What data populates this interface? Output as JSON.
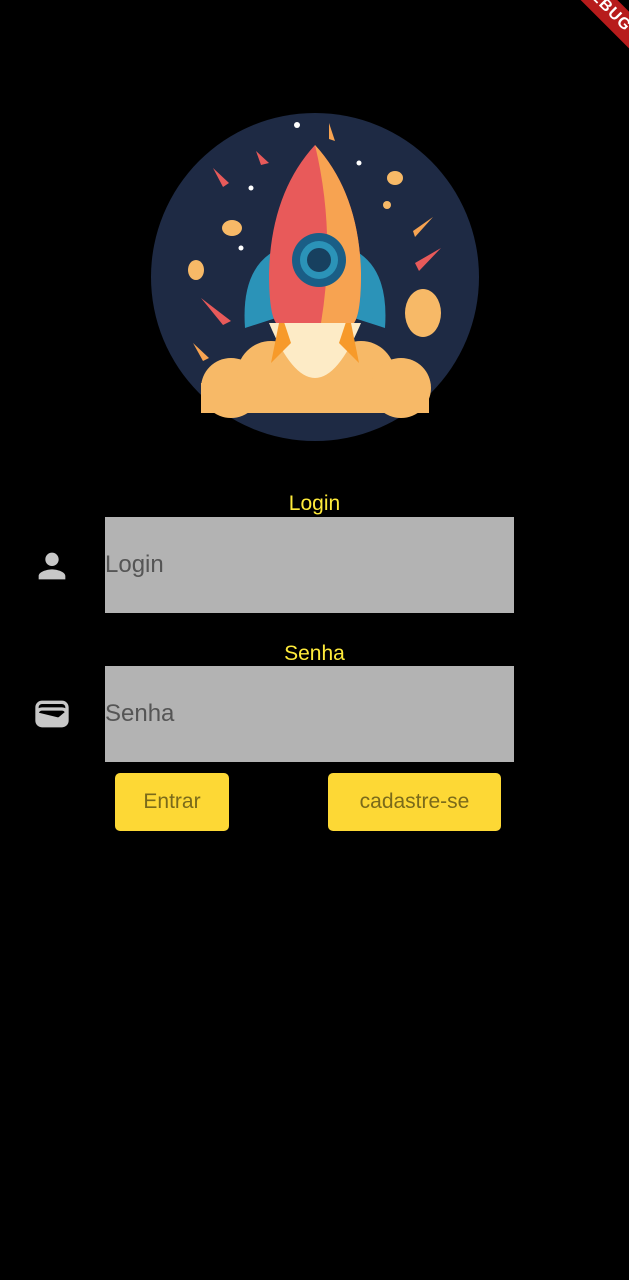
{
  "debug_banner": "DEBUG",
  "logo": {
    "icon": "rocket-logo"
  },
  "login": {
    "label": "Login",
    "placeholder": "Login",
    "icon": "person-icon"
  },
  "password": {
    "label": "Senha",
    "placeholder": "Senha",
    "icon": "wallet-icon"
  },
  "buttons": {
    "enter_label": "Entrar",
    "signup_label": "cadastre-se"
  },
  "colors": {
    "background": "#000000",
    "label_yellow": "#ffeb3b",
    "button_yellow": "#fdd835",
    "field_gray": "#b3b3b3"
  }
}
